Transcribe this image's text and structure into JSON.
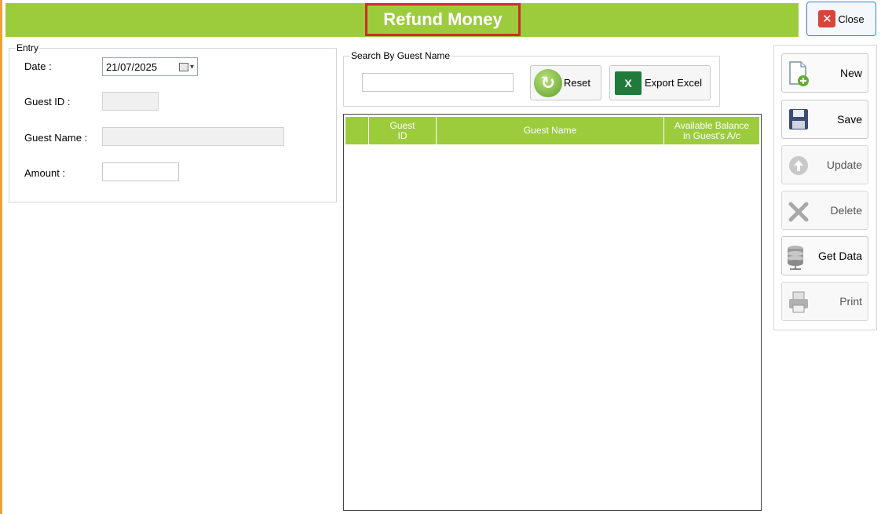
{
  "header": {
    "title": "Refund Money",
    "close_label": "Close"
  },
  "entry": {
    "legend": "Entry",
    "date_label": "Date :",
    "date_value": "21/07/2025",
    "guest_id_label": "Guest ID :",
    "guest_id_value": "",
    "guest_name_label": "Guest Name :",
    "guest_name_value": "",
    "amount_label": "Amount :",
    "amount_value": ""
  },
  "search": {
    "legend": "Search By Guest Name",
    "value": "",
    "reset_label": "Reset",
    "excel_label": "Export Excel"
  },
  "grid": {
    "columns": [
      "",
      "Guest ID",
      "Guest Name",
      "Available Balance in Guest's A/c"
    ],
    "col_guest_id_line1": "Guest",
    "col_guest_id_line2": "ID",
    "col_guest_name": "Guest Name",
    "col_balance_line1": "Available Balance",
    "col_balance_line2": "in Guest's A/c",
    "rows": []
  },
  "actions": {
    "new": "New",
    "save": "Save",
    "update": "Update",
    "delete": "Delete",
    "get_data": "Get Data",
    "print": "Print"
  },
  "colors": {
    "accent_green": "#9ccc3c",
    "title_border": "#d42a2a",
    "close_red": "#d8433a"
  }
}
